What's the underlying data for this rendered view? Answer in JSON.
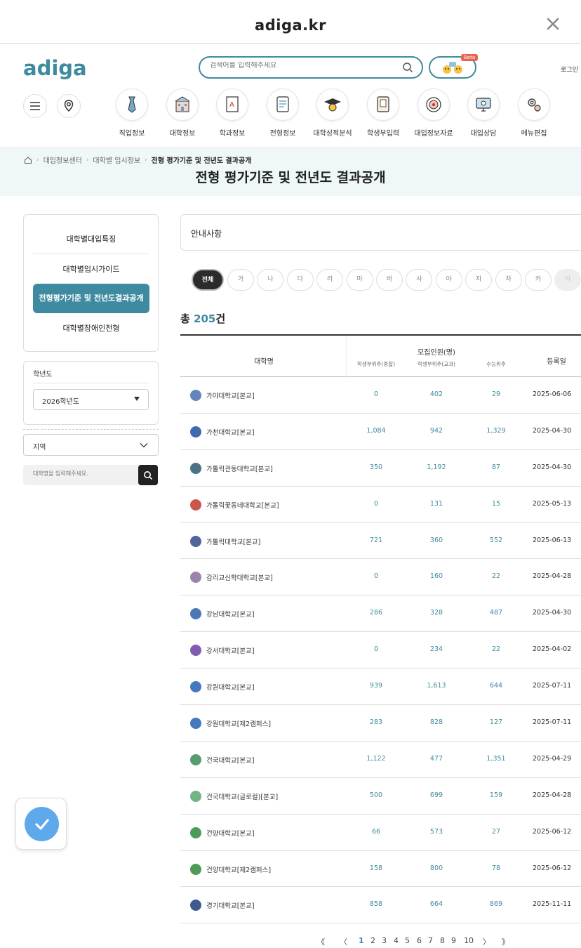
{
  "browser": {
    "url": "adiga.kr"
  },
  "header": {
    "logo": "adiga",
    "search_placeholder": "검색어를 입력해주세요",
    "beta_badge": "Beta",
    "login": "로그인",
    "nav": [
      {
        "label": "직업정보",
        "icon": "tie-icon"
      },
      {
        "label": "대학정보",
        "icon": "building-icon"
      },
      {
        "label": "학과정보",
        "icon": "book-icon"
      },
      {
        "label": "전형정보",
        "icon": "document-icon"
      },
      {
        "label": "대학성적분석",
        "icon": "graduation-cap-icon"
      },
      {
        "label": "학생부입력",
        "icon": "notebook-icon"
      },
      {
        "label": "대입정보자료",
        "icon": "target-icon"
      },
      {
        "label": "대입상담",
        "icon": "monitor-icon"
      },
      {
        "label": "메뉴편집",
        "icon": "gear-icon"
      }
    ]
  },
  "breadcrumb": [
    "대입정보센터",
    "대학별 입시정보",
    "전형 평가기준 및 전년도 결과공개"
  ],
  "page_title": "전형 평가기준 및 전년도 결과공개",
  "sidebar": {
    "items": [
      "대학별대입특징",
      "대학별입시가이드",
      "전형평가기준 및 전년도결과공개",
      "대학별장애인전형"
    ],
    "year_label": "학년도",
    "year_value": "2026학년도",
    "region_value": "지역",
    "uni_placeholder": "대학명을 입력해주세요."
  },
  "notice": "안내사항",
  "filters": [
    "전체",
    "가",
    "나",
    "다",
    "라",
    "마",
    "바",
    "사",
    "아",
    "자",
    "차",
    "카",
    "타"
  ],
  "total": {
    "prefix": "총 ",
    "count": "205",
    "suffix": "건"
  },
  "table": {
    "headers": {
      "name": "대학명",
      "group": "모집인원(명)",
      "sub": [
        "학생부위주(종합)",
        "학생부위주(교과)",
        "수능위주"
      ],
      "date": "등록일"
    },
    "rows": [
      {
        "name": "가야대학교[본교]",
        "a": "0",
        "b": "402",
        "c": "29",
        "date": "2025-06-06",
        "color": "#4a6fb0"
      },
      {
        "name": "가천대학교[본교]",
        "a": "1,084",
        "b": "942",
        "c": "1,329",
        "date": "2025-04-30",
        "color": "#1f4fa0"
      },
      {
        "name": "가톨릭관동대학교[본교]",
        "a": "350",
        "b": "1,192",
        "c": "87",
        "date": "2025-04-30",
        "color": "#2b5a6e"
      },
      {
        "name": "가톨릭꽃동네대학교[본교]",
        "a": "0",
        "b": "131",
        "c": "15",
        "date": "2025-05-13",
        "color": "#c0392b"
      },
      {
        "name": "가톨릭대학교[본교]",
        "a": "721",
        "b": "360",
        "c": "552",
        "date": "2025-06-13",
        "color": "#34498a"
      },
      {
        "name": "감리교신학대학교[본교]",
        "a": "0",
        "b": "160",
        "c": "22",
        "date": "2025-04-28",
        "color": "#8a6d9e"
      },
      {
        "name": "강남대학교[본교]",
        "a": "286",
        "b": "328",
        "c": "487",
        "date": "2025-04-30",
        "color": "#2e5fa8"
      },
      {
        "name": "강서대학교[본교]",
        "a": "0",
        "b": "234",
        "c": "22",
        "date": "2025-04-02",
        "color": "#6b3fa0"
      },
      {
        "name": "강원대학교[본교]",
        "a": "939",
        "b": "1,613",
        "c": "644",
        "date": "2025-07-11",
        "color": "#2361b0"
      },
      {
        "name": "강원대학교[제2캠퍼스]",
        "a": "283",
        "b": "828",
        "c": "127",
        "date": "2025-07-11",
        "color": "#2361b0"
      },
      {
        "name": "건국대학교[본교]",
        "a": "1,122",
        "b": "477",
        "c": "1,351",
        "date": "2025-04-29",
        "color": "#3a8a55"
      },
      {
        "name": "건국대학교(글로컬)[본교]",
        "a": "500",
        "b": "699",
        "c": "159",
        "date": "2025-04-28",
        "color": "#5aa66e"
      },
      {
        "name": "건양대학교[본교]",
        "a": "66",
        "b": "573",
        "c": "27",
        "date": "2025-06-12",
        "color": "#2e8a3e"
      },
      {
        "name": "건양대학교[제2캠퍼스]",
        "a": "158",
        "b": "800",
        "c": "78",
        "date": "2025-06-12",
        "color": "#2e8a3e"
      },
      {
        "name": "경기대학교[본교]",
        "a": "858",
        "b": "664",
        "c": "869",
        "date": "2025-11-11",
        "color": "#1d3d7a"
      }
    ]
  },
  "pager": {
    "first": "《",
    "prev": "〈",
    "pages": [
      "1",
      "2",
      "3",
      "4",
      "5",
      "6",
      "7",
      "8",
      "9",
      "10"
    ],
    "next": "〉",
    "last": "》"
  },
  "colors": {
    "accent": "#3e8aa0",
    "band": "#eff7f8",
    "float_button": "#5ea9ec"
  }
}
